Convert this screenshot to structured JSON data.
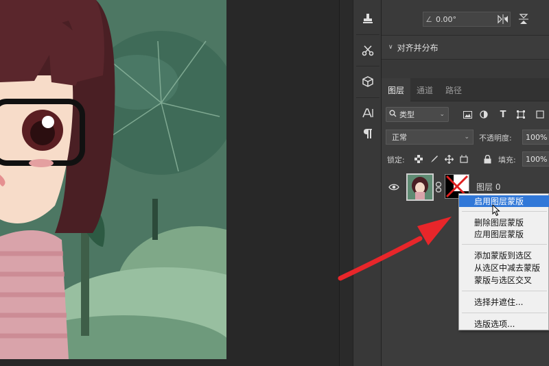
{
  "canvas": {
    "illustration": "cartoon-girl-with-glasses-and-lotus-leaves"
  },
  "tool_strip": {
    "items": [
      "stamp-icon",
      "scissors-icon",
      "cube-icon",
      "character-icon",
      "paragraph-icon"
    ]
  },
  "properties_panel": {
    "angle_value": "0.00°",
    "align_section_title": "对齐并分布"
  },
  "layers_panel": {
    "tabs": [
      {
        "label": "图层",
        "active": true
      },
      {
        "label": "通道",
        "active": false
      },
      {
        "label": "路径",
        "active": false
      }
    ],
    "filter_label": "类型",
    "blend_mode": "正常",
    "opacity_label": "不透明度:",
    "opacity_value": "100%",
    "lock_label": "锁定:",
    "fill_label": "填充:",
    "fill_value": "100%",
    "layer": {
      "name": "图层 0"
    }
  },
  "context_menu": {
    "items": [
      {
        "label": "启用图层蒙版",
        "highlighted": true
      },
      {
        "label": "删除图层蒙版"
      },
      {
        "label": "应用图层蒙版"
      },
      {
        "label": "添加蒙版到选区"
      },
      {
        "label": "从选区中减去蒙版"
      },
      {
        "label": "蒙版与选区交叉"
      },
      {
        "label": "选择并遮住..."
      },
      {
        "label": "选版选项..."
      }
    ]
  },
  "annotation": {
    "arrow_color": "#e8262a"
  },
  "colors": {
    "panel_bg": "#3c3c3c",
    "menu_highlight": "#3178d8",
    "menu_bg": "#f0f0f0"
  }
}
